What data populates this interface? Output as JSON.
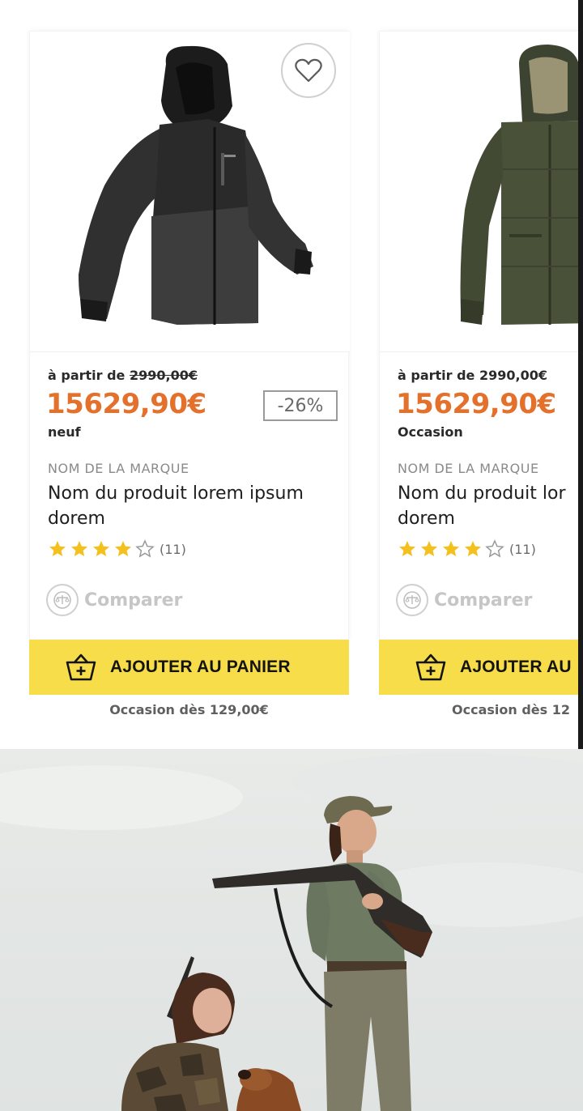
{
  "colors": {
    "accent_price": "#e3702b",
    "cta_yellow": "#f7dd4a",
    "star_yellow": "#f4c01e"
  },
  "products": [
    {
      "image_icon": "black-hooded-jacket",
      "price_from_prefix": "à partir de",
      "price_from_old": "2990,00€",
      "price": "15629,90€",
      "discount": "-26%",
      "condition": "neuf",
      "brand": "NOM DE LA MARQUE",
      "name": "Nom du produit lorem ipsum dorem",
      "rating": 4,
      "rating_max": 5,
      "rating_count": "(11)",
      "compare_label": "Comparer",
      "add_to_cart_label": "AJOUTER AU PANIER",
      "used_from": "Occasion dès 129,00€"
    },
    {
      "image_icon": "olive-parka",
      "price_from_prefix": "à partir de",
      "price_from_old": "2990,00€",
      "price": "15629,90€",
      "condition": "Occasion",
      "brand": "NOM DE LA MARQUE",
      "name": "Nom du produit lor dorem",
      "rating": 4,
      "rating_max": 5,
      "rating_count": "(11)",
      "compare_label": "Comparer",
      "add_to_cart_label": "AJOUTER AU",
      "used_from": "Occasion dès 12"
    }
  ],
  "hero": {
    "image_icon": "hunters-outdoor-photo"
  }
}
